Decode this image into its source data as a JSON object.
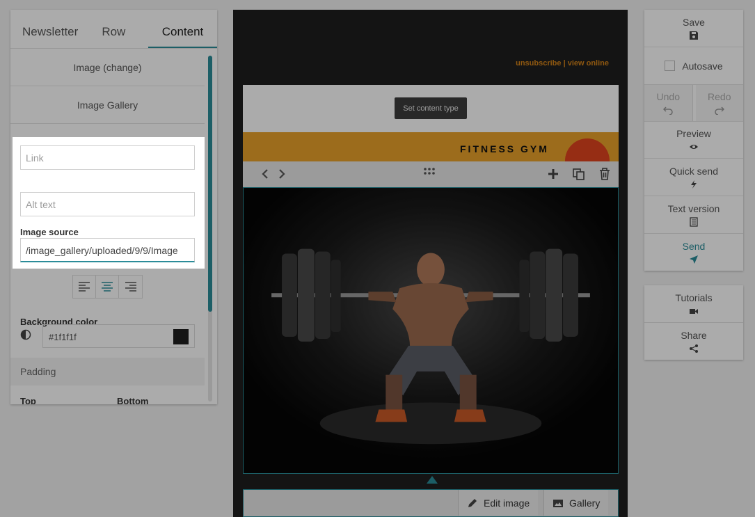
{
  "left_panel": {
    "tabs": [
      "Newsletter",
      "Row",
      "Content"
    ],
    "active_tab": "Content",
    "image_change_label": "Image (change)",
    "image_gallery_label": "Image Gallery",
    "link_placeholder": "Link",
    "alt_placeholder": "Alt text",
    "image_source_label": "Image source",
    "image_source_value": "/image_gallery/uploaded/9/9/Image",
    "background_color_label": "Background color",
    "background_color_value": "#1f1f1f",
    "padding_label": "Padding",
    "top_label": "Top",
    "bottom_label": "Bottom"
  },
  "editor": {
    "unsubscribe_text": "unsubscribe | view online",
    "set_content_type": "Set content type",
    "brand_text": "FITNESS GYM",
    "edit_image_label": "Edit image",
    "gallery_label": "Gallery"
  },
  "right_panel": {
    "save": "Save",
    "autosave": "Autosave",
    "undo": "Undo",
    "redo": "Redo",
    "preview": "Preview",
    "quick_send": "Quick send",
    "text_version": "Text version",
    "send": "Send",
    "tutorials": "Tutorials",
    "share": "Share"
  },
  "colors": {
    "accent": "#2b8c99",
    "orange": "#e9a22a",
    "canvas_bg": "#1f1f1f"
  }
}
